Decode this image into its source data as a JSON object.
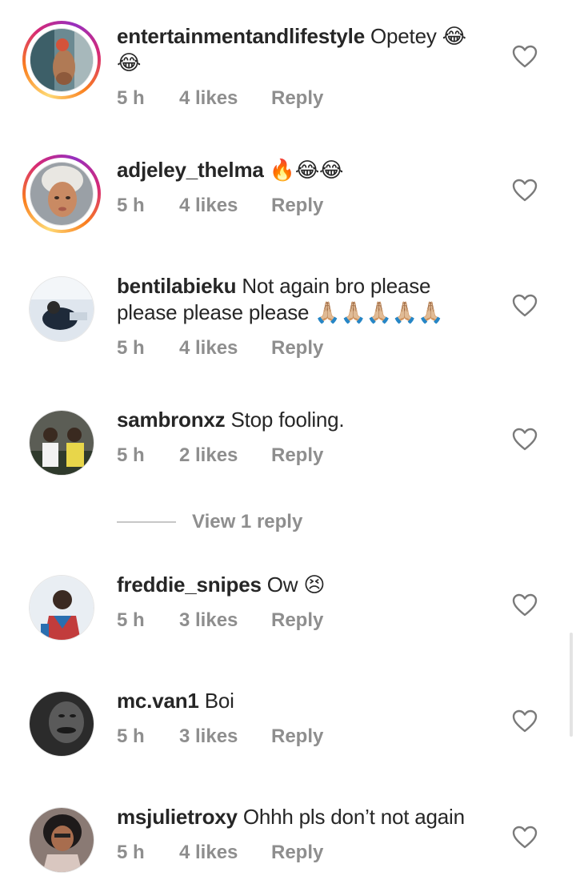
{
  "comments": [
    {
      "username": "entertainmentandlifestyle",
      "text": "Opetey 😂 😂",
      "time": "5 h",
      "likes": "4 likes",
      "reply": "Reply",
      "avatar_ring": "story"
    },
    {
      "username": "adjeley_thelma",
      "text": "🔥😂😂",
      "time": "5 h",
      "likes": "4 likes",
      "reply": "Reply",
      "avatar_ring": "story"
    },
    {
      "username": "bentilabieku",
      "text": "Not again bro please please please please 🙏🏼🙏🏼🙏🏼🙏🏼🙏🏼",
      "time": "5 h",
      "likes": "4 likes",
      "reply": "Reply",
      "avatar_ring": "none"
    },
    {
      "username": "sambronxz",
      "text": "Stop fooling.",
      "time": "5 h",
      "likes": "2 likes",
      "reply": "Reply",
      "avatar_ring": "none"
    },
    {
      "username": "freddie_snipes",
      "text": "Ow 😣",
      "time": "5 h",
      "likes": "3 likes",
      "reply": "Reply",
      "avatar_ring": "none"
    },
    {
      "username": "mc.van1",
      "text": "Boi",
      "time": "5 h",
      "likes": "3 likes",
      "reply": "Reply",
      "avatar_ring": "none"
    },
    {
      "username": "msjulietroxy",
      "text": "Ohhh pls don’t not again",
      "time": "5 h",
      "likes": "4 likes",
      "reply": "Reply",
      "avatar_ring": "none"
    }
  ],
  "view_replies": {
    "label": "View 1 reply"
  },
  "icons": {
    "like": "heart-outline-icon"
  },
  "colors": {
    "text": "#262626",
    "meta": "#8e8e8e",
    "divider": "#c7c7c7"
  }
}
